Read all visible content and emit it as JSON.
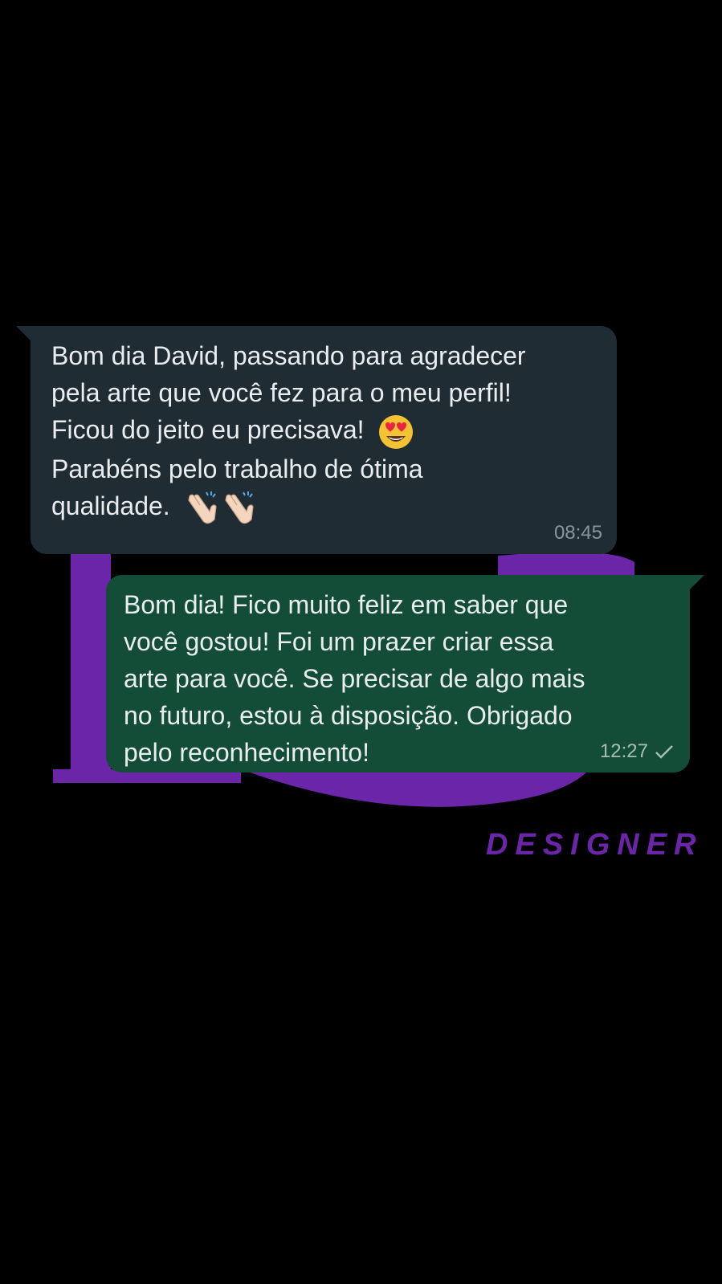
{
  "colors": {
    "background": "#000000",
    "incoming_bubble": "#202c33",
    "outgoing_bubble": "#134d37",
    "text": "#e9edef",
    "watermark_purple": "#6a25a8"
  },
  "watermark": {
    "text": "DESIGNER"
  },
  "messages": {
    "incoming": {
      "lines": [
        "Bom dia David, passando para agradecer",
        "pela arte que você fez para o meu perfil!",
        "Ficou do jeito eu precisava!",
        "Parabéns pelo trabalho de ótima",
        "qualidade."
      ],
      "emojis": [
        "smiling-face-with-heart-eyes-emoji",
        "clapping-hands-emoji",
        "clapping-hands-emoji"
      ],
      "time": "08:45"
    },
    "outgoing": {
      "lines": [
        "Bom dia! Fico muito feliz em saber que",
        "você gostou! Foi um prazer criar essa",
        "arte para você. Se precisar de algo mais",
        "no futuro, estou à disposição. Obrigado",
        "pelo reconhecimento!"
      ],
      "time": "12:27",
      "status_icon": "single-check-icon"
    }
  }
}
